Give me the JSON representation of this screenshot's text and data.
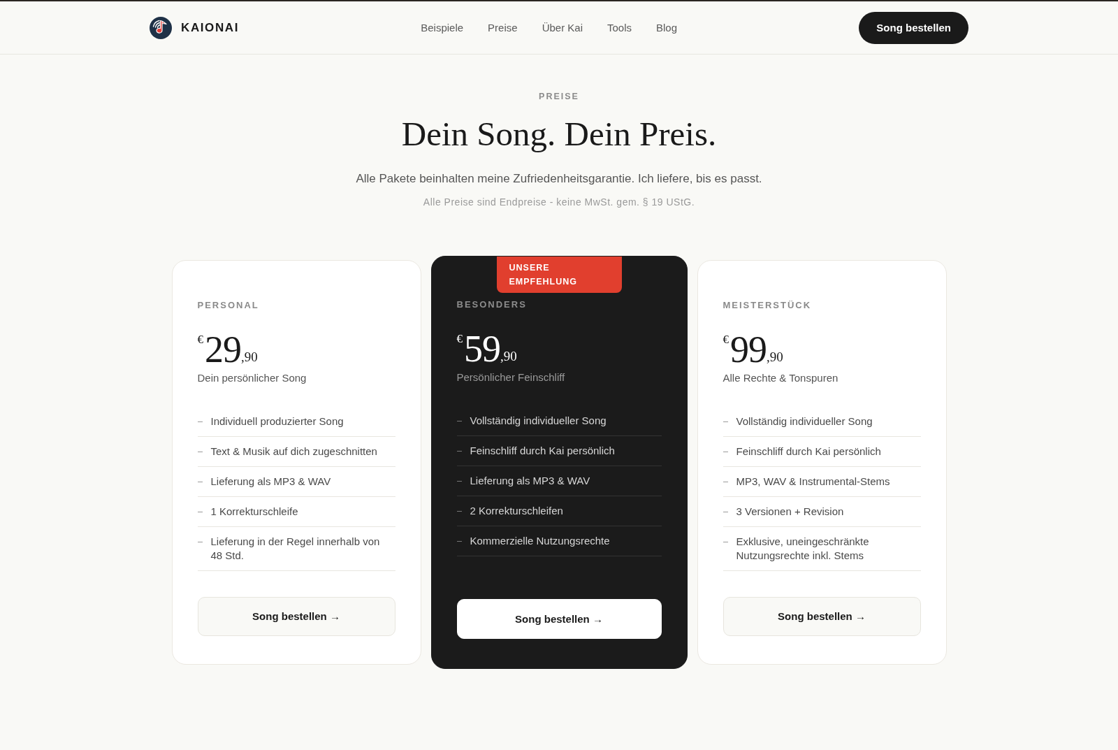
{
  "header": {
    "brand": "KAIONAI",
    "nav": [
      "Beispiele",
      "Preise",
      "Über Kai",
      "Tools",
      "Blog"
    ],
    "cta": "Song bestellen"
  },
  "pricing": {
    "eyebrow": "PREISE",
    "title": "Dein Song. Dein Preis.",
    "subtitle": "Alle Pakete beinhalten meine Zufriedenheitsgarantie. Ich liefere, bis es passt.",
    "note": "Alle Preise sind Endpreise - keine MwSt. gem. § 19 UStG.",
    "plans": [
      {
        "name": "PERSONAL",
        "featured": false,
        "currency": "€",
        "amount": "29",
        "cents": ",90",
        "tagline": "Dein persönlicher Song",
        "features": [
          "Individuell produzierter Song",
          "Text & Musik auf dich zugeschnitten",
          "Lieferung als MP3 & WAV",
          "1 Korrekturschleife",
          "Lieferung in der Regel innerhalb von 48 Std."
        ],
        "button": "Song bestellen →"
      },
      {
        "name": "BESONDERS",
        "featured": true,
        "badge": "UNSERE EMPFEHLUNG",
        "currency": "€",
        "amount": "59",
        "cents": ",90",
        "tagline": "Persönlicher Feinschliff",
        "features": [
          "Vollständig individueller Song",
          "Feinschliff durch Kai persönlich",
          "Lieferung als MP3 & WAV",
          "2 Korrekturschleifen",
          "Kommerzielle Nutzungsrechte"
        ],
        "button": "Song bestellen →"
      },
      {
        "name": "MEISTERSTÜCK",
        "featured": false,
        "currency": "€",
        "amount": "99",
        "cents": ",90",
        "tagline": "Alle Rechte & Tonspuren",
        "features": [
          "Vollständig individueller Song",
          "Feinschliff durch Kai persönlich",
          "MP3, WAV & Instrumental-Stems",
          "3 Versionen + Revision",
          "Exklusive, uneingeschränkte Nutzungsrechte inkl. Stems"
        ],
        "button": "Song bestellen →"
      }
    ]
  }
}
